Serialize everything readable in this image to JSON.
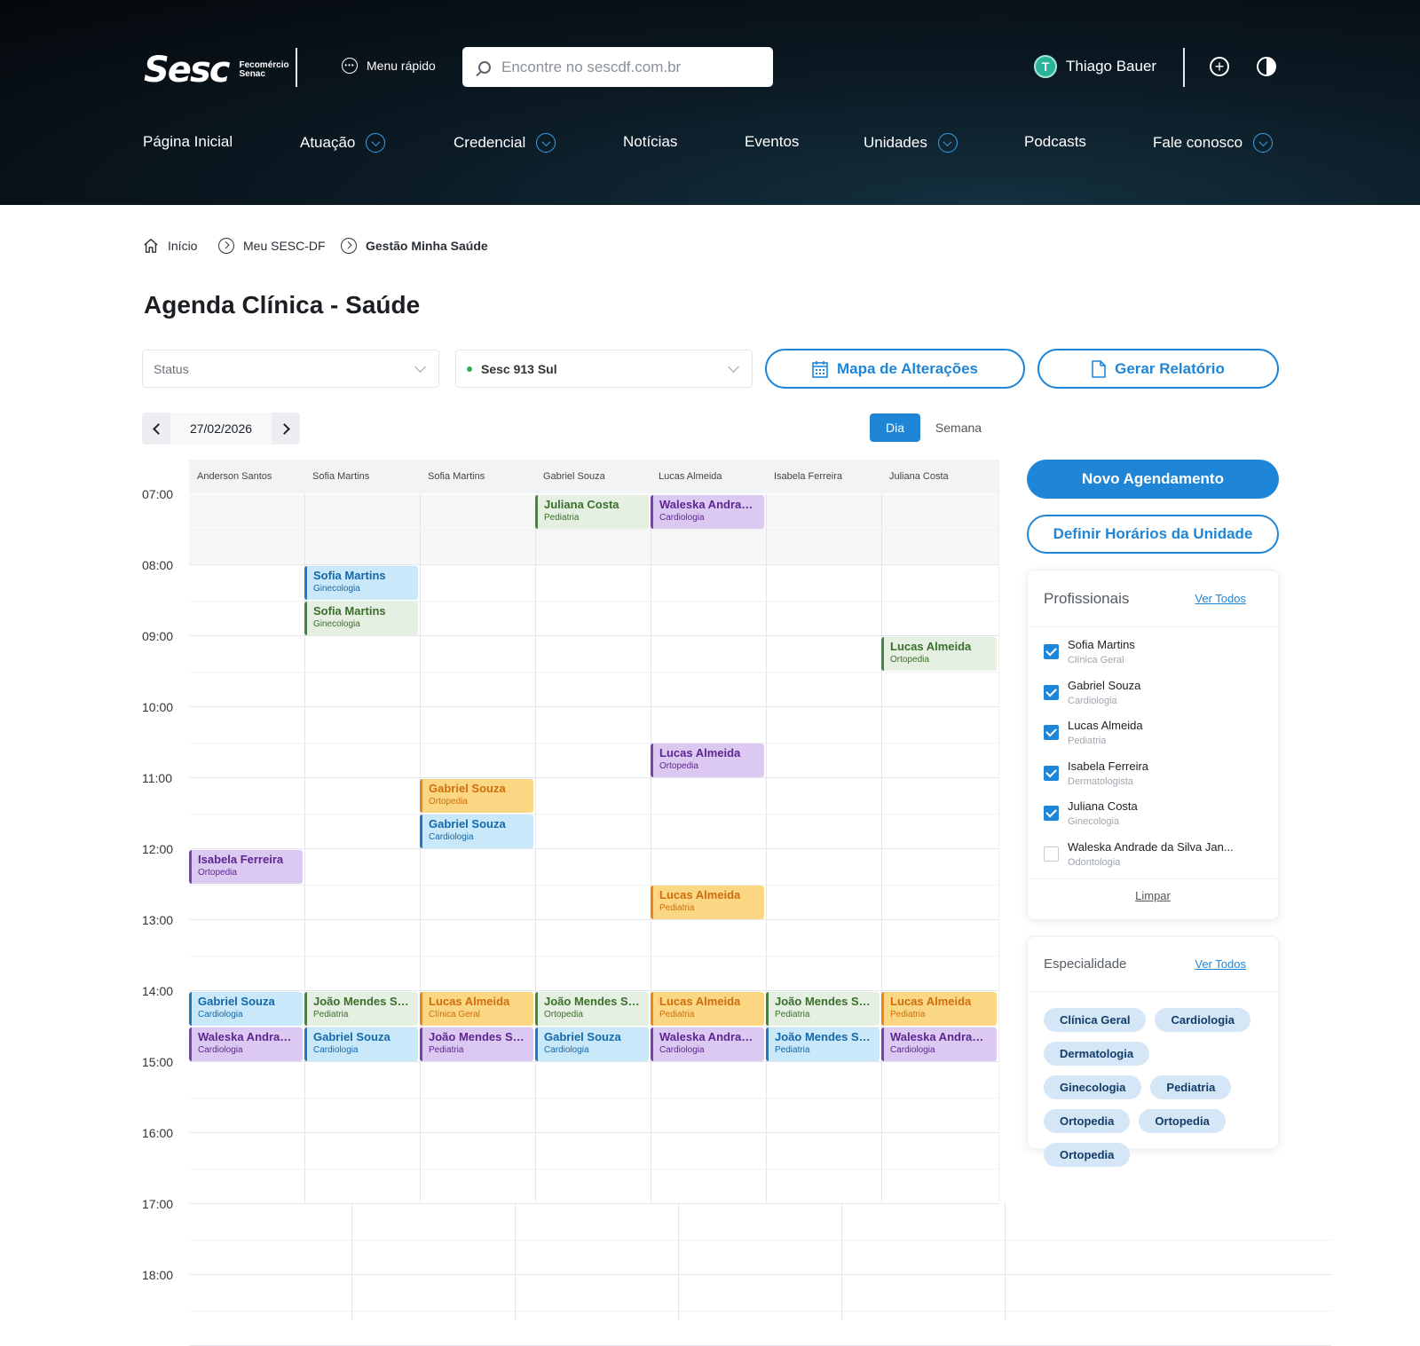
{
  "header": {
    "logo_main": "Sesc",
    "logo_sub_1": "Fecomércio",
    "logo_sub_2": "Senac",
    "quick_menu": "Menu rápido",
    "search_placeholder": "Encontre no sescdf.com.br",
    "user_initial": "T",
    "user_name": "Thiago Bauer"
  },
  "nav": [
    {
      "label": "Página Inicial",
      "dropdown": false
    },
    {
      "label": "Atuação",
      "dropdown": true
    },
    {
      "label": "Credencial",
      "dropdown": true
    },
    {
      "label": "Notícias",
      "dropdown": false
    },
    {
      "label": "Eventos",
      "dropdown": false
    },
    {
      "label": "Unidades",
      "dropdown": true
    },
    {
      "label": "Podcasts",
      "dropdown": false
    },
    {
      "label": "Fale conosco",
      "dropdown": true
    }
  ],
  "breadcrumb": [
    "Início",
    "Meu SESC-DF",
    "Gestão Minha Saúde"
  ],
  "page_title": "Agenda Clínica - Saúde",
  "filters": {
    "status_placeholder": "Status",
    "unit_value": "Sesc 913 Sul",
    "map_button": "Mapa de Alterações",
    "report_button": "Gerar Relatório"
  },
  "date_nav": {
    "date": "27/02/2026"
  },
  "view_toggle": {
    "day": "Dia",
    "week": "Semana",
    "active": "day"
  },
  "calendar": {
    "columns": [
      "Anderson Santos",
      "Sofia Martins",
      "Sofia Martins",
      "Gabriel Souza",
      "Lucas Almeida",
      "Isabela Ferreira",
      "Juliana Costa"
    ],
    "hours": [
      "07:00",
      "08:00",
      "09:00",
      "10:00",
      "11:00",
      "12:00",
      "13:00",
      "14:00",
      "15:00",
      "16:00",
      "17:00",
      "18:00"
    ],
    "events": [
      {
        "col": 3,
        "start": "07:00",
        "name": "Juliana Costa",
        "spec": "Pediatria",
        "color": "green"
      },
      {
        "col": 4,
        "start": "07:00",
        "name": "Waleska Andrade...",
        "spec": "Cardiologia",
        "color": "purple"
      },
      {
        "col": 1,
        "start": "08:00",
        "name": "Sofia Martins",
        "spec": "Ginecologia",
        "color": "blue"
      },
      {
        "col": 1,
        "start": "08:30",
        "name": "Sofia Martins",
        "spec": "Ginecologia",
        "color": "green"
      },
      {
        "col": 6,
        "start": "09:00",
        "name": "Lucas Almeida",
        "spec": "Ortopedia",
        "color": "green"
      },
      {
        "col": 4,
        "start": "10:30",
        "name": "Lucas Almeida",
        "spec": "Ortopedia",
        "color": "purple"
      },
      {
        "col": 2,
        "start": "11:00",
        "name": "Gabriel Souza",
        "spec": "Ortopedia",
        "color": "orange"
      },
      {
        "col": 2,
        "start": "11:30",
        "name": "Gabriel Souza",
        "spec": "Cardiologia",
        "color": "blue"
      },
      {
        "col": 0,
        "start": "12:00",
        "name": "Isabela Ferreira",
        "spec": "Ortopedia",
        "color": "purple"
      },
      {
        "col": 4,
        "start": "12:30",
        "name": "Lucas Almeida",
        "spec": "Pediatria",
        "color": "orange"
      },
      {
        "col": 0,
        "start": "14:00",
        "name": "Gabriel Souza",
        "spec": "Cardiologia",
        "color": "blue"
      },
      {
        "col": 1,
        "start": "14:00",
        "name": "João Mendes Silva",
        "spec": "Pediatria",
        "color": "green"
      },
      {
        "col": 2,
        "start": "14:00",
        "name": "Lucas Almeida",
        "spec": "Clínica Geral",
        "color": "orange"
      },
      {
        "col": 3,
        "start": "14:00",
        "name": "João Mendes Silva",
        "spec": "Ortopedia",
        "color": "green"
      },
      {
        "col": 4,
        "start": "14:00",
        "name": "Lucas Almeida",
        "spec": "Pediatria",
        "color": "orange"
      },
      {
        "col": 5,
        "start": "14:00",
        "name": "João Mendes Silva",
        "spec": "Pediatria",
        "color": "green"
      },
      {
        "col": 6,
        "start": "14:00",
        "name": "Lucas Almeida",
        "spec": "Pediatria",
        "color": "orange"
      },
      {
        "col": 0,
        "start": "14:30",
        "name": "Waleska Andrade...",
        "spec": "Cardiologia",
        "color": "purple"
      },
      {
        "col": 1,
        "start": "14:30",
        "name": "Gabriel Souza",
        "spec": "Cardiologia",
        "color": "blue"
      },
      {
        "col": 2,
        "start": "14:30",
        "name": "João Mendes Silva",
        "spec": "Pediatria",
        "color": "purple"
      },
      {
        "col": 3,
        "start": "14:30",
        "name": "Gabriel Souza",
        "spec": "Cardiologia",
        "color": "blue"
      },
      {
        "col": 4,
        "start": "14:30",
        "name": "Waleska Andrade...",
        "spec": "Cardiologia",
        "color": "purple"
      },
      {
        "col": 5,
        "start": "14:30",
        "name": "João Mendes Silva",
        "spec": "Pediatria",
        "color": "blue"
      },
      {
        "col": 6,
        "start": "14:30",
        "name": "Waleska Andrade...",
        "spec": "Cardiologia",
        "color": "purple"
      }
    ]
  },
  "actions": {
    "new_appointment": "Novo Agendamento",
    "define_hours": "Definir Horários da Unidade"
  },
  "professionals": {
    "title": "Profissionais",
    "see_all": "Ver Todos",
    "clear": "Limpar",
    "items": [
      {
        "name": "Sofia Martins",
        "spec": "Clínica Geral",
        "checked": true
      },
      {
        "name": "Gabriel Souza",
        "spec": "Cardiologia",
        "checked": true
      },
      {
        "name": "Lucas Almeida",
        "spec": "Pediatria",
        "checked": true
      },
      {
        "name": "Isabela Ferreira",
        "spec": "Dermatologista",
        "checked": true
      },
      {
        "name": "Juliana Costa",
        "spec": "Ginecologia",
        "checked": true
      },
      {
        "name": "Waleska Andrade da Silva Jan...",
        "spec": "Odontologia",
        "checked": false
      }
    ]
  },
  "specialties": {
    "title": "Especialidade",
    "see_all": "Ver Todos",
    "chips": [
      "Clínica Geral",
      "Cardiologia",
      "Dermatologia",
      "Ginecologia",
      "Pediatria",
      "Ortopedia",
      "Ortopedia",
      "Ortopedia"
    ]
  },
  "colors": {
    "accent": "#1f86d7",
    "event_green": "#e6f0e2",
    "event_blue": "#c9e9fa",
    "event_purple": "#dcc9f2",
    "event_orange": "#fbd784"
  }
}
